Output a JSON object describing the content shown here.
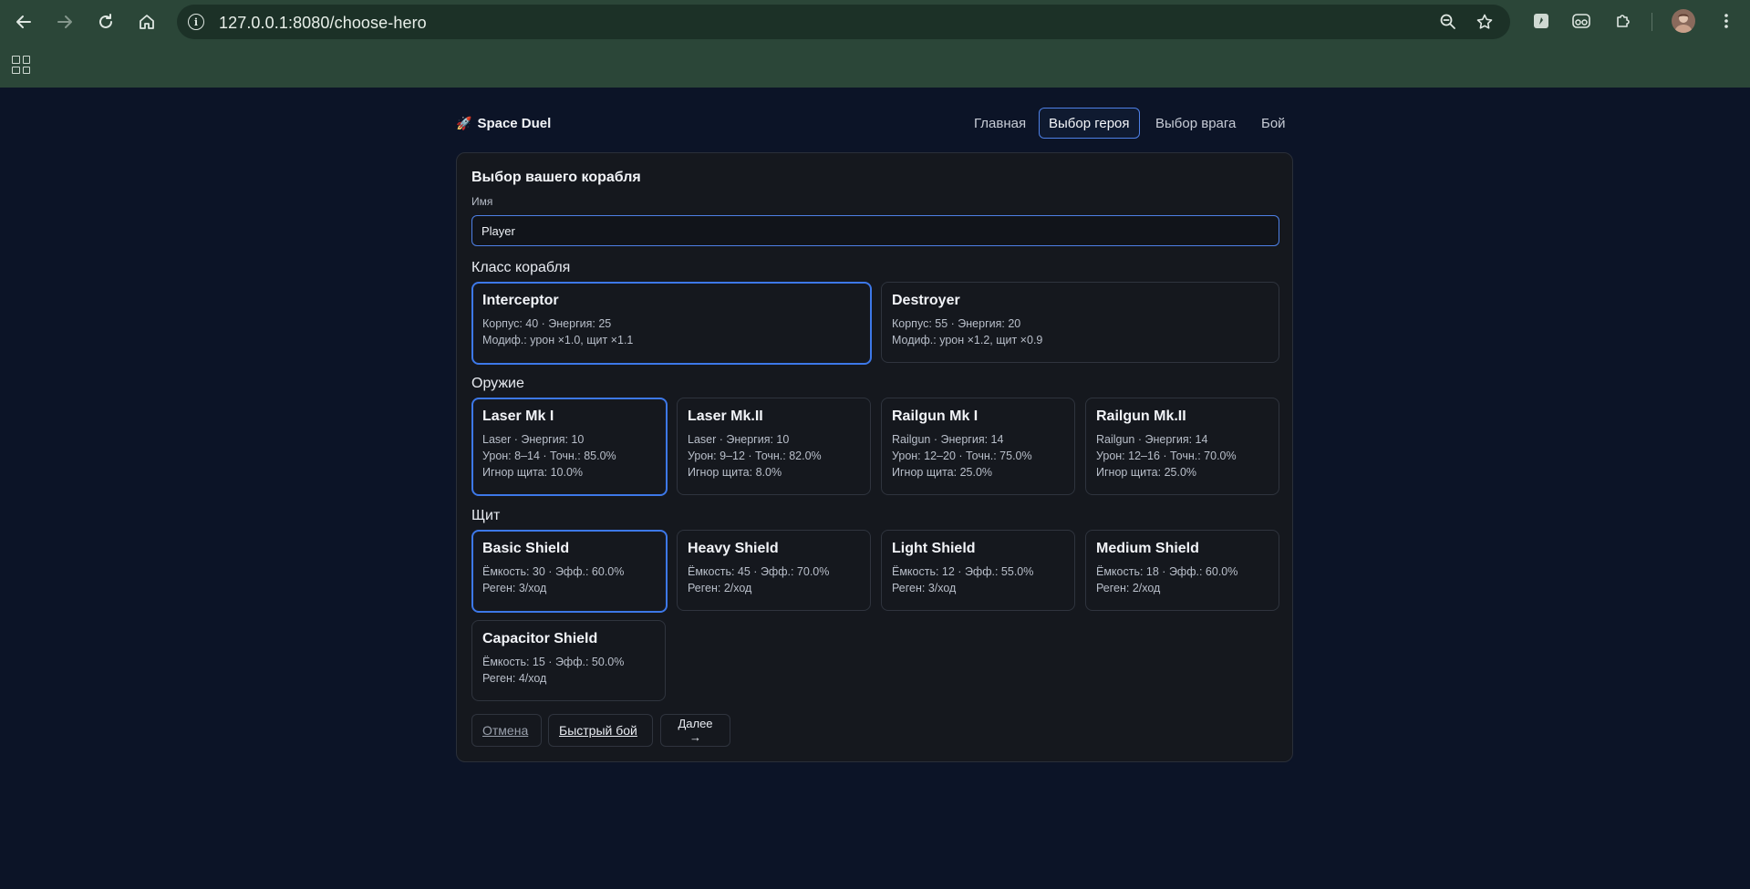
{
  "browser": {
    "url": "127.0.0.1:8080/choose-hero"
  },
  "header": {
    "brand": "Space Duel",
    "nav": [
      {
        "label": "Главная"
      },
      {
        "label": "Выбор героя"
      },
      {
        "label": "Выбор врага"
      },
      {
        "label": "Бой"
      }
    ],
    "active_nav": "Выбор героя"
  },
  "form": {
    "title": "Выбор вашего корабля",
    "name_label": "Имя",
    "name_value": "Player",
    "class_label": "Класс корабля",
    "weapon_label": "Оружие",
    "shield_label": "Щит"
  },
  "ship_classes": [
    {
      "name": "Interceptor",
      "line1": "Корпус: 40 · Энергия: 25",
      "line2": "Модиф.: урон ×1.0, щит ×1.1",
      "selected": true
    },
    {
      "name": "Destroyer",
      "line1": "Корпус: 55 · Энергия: 20",
      "line2": "Модиф.: урон ×1.2, щит ×0.9",
      "selected": false
    }
  ],
  "weapons": [
    {
      "name": "Laser Mk I",
      "line1": "Laser · Энергия: 10",
      "line2": "Урон: 8–14 · Точн.: 85.0%",
      "line3": "Игнор щита: 10.0%",
      "selected": true
    },
    {
      "name": "Laser Mk.II",
      "line1": "Laser · Энергия: 10",
      "line2": "Урон: 9–12 · Точн.: 82.0%",
      "line3": "Игнор щита: 8.0%",
      "selected": false
    },
    {
      "name": "Railgun Mk I",
      "line1": "Railgun · Энергия: 14",
      "line2": "Урон: 12–20 · Точн.: 75.0%",
      "line3": "Игнор щита: 25.0%",
      "selected": false
    },
    {
      "name": "Railgun Mk.II",
      "line1": "Railgun · Энергия: 14",
      "line2": "Урон: 12–16 · Точн.: 70.0%",
      "line3": "Игнор щита: 25.0%",
      "selected": false
    }
  ],
  "shields": [
    {
      "name": "Basic Shield",
      "line1": "Ёмкость: 30 · Эфф.: 60.0%",
      "line2": "Реген: 3/ход",
      "selected": true
    },
    {
      "name": "Heavy Shield",
      "line1": "Ёмкость: 45 · Эфф.: 70.0%",
      "line2": "Реген: 2/ход",
      "selected": false
    },
    {
      "name": "Light Shield",
      "line1": "Ёмкость: 12 · Эфф.: 55.0%",
      "line2": "Реген: 3/ход",
      "selected": false
    },
    {
      "name": "Medium Shield",
      "line1": "Ёмкость: 18 · Эфф.: 60.0%",
      "line2": "Реген: 2/ход",
      "selected": false
    },
    {
      "name": "Capacitor Shield",
      "line1": "Ёмкость: 15 · Эфф.: 50.0%",
      "line2": "Реген: 4/ход",
      "selected": false
    }
  ],
  "actions": {
    "cancel": "Отмена",
    "quick_battle": "Быстрый бой",
    "next": "Далее →"
  },
  "colors": {
    "accent": "#3d78e8",
    "page_bg": "#0c1427",
    "panel_bg": "#15181e",
    "chrome_bg": "#2b4638"
  }
}
